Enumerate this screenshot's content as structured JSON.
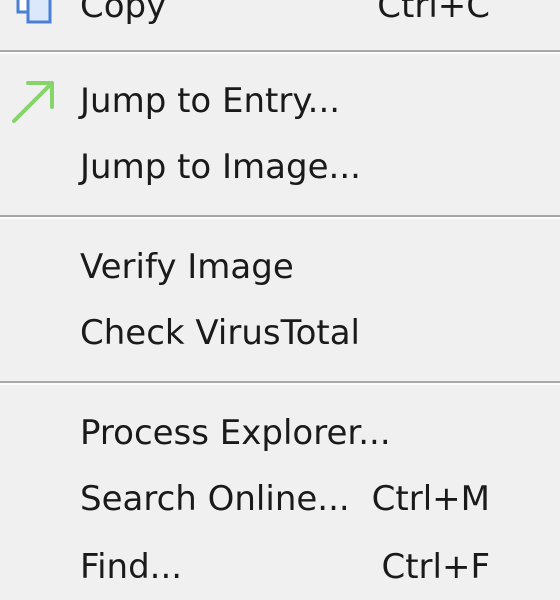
{
  "context_menu": {
    "items": [
      {
        "label": "Copy",
        "shortcut": "Ctrl+C",
        "icon": "copy-icon"
      },
      {
        "label": "Jump to Entry...",
        "shortcut": "",
        "icon": "jump-arrow-icon",
        "icon_color": "#86d46a"
      },
      {
        "label": "Jump to Image...",
        "shortcut": ""
      },
      {
        "label": "Verify Image",
        "shortcut": ""
      },
      {
        "label": "Check VirusTotal",
        "shortcut": ""
      },
      {
        "label": "Process Explorer...",
        "shortcut": ""
      },
      {
        "label": "Search Online...",
        "shortcut": "Ctrl+M"
      },
      {
        "label": "Find...",
        "shortcut": "Ctrl+F"
      }
    ]
  }
}
